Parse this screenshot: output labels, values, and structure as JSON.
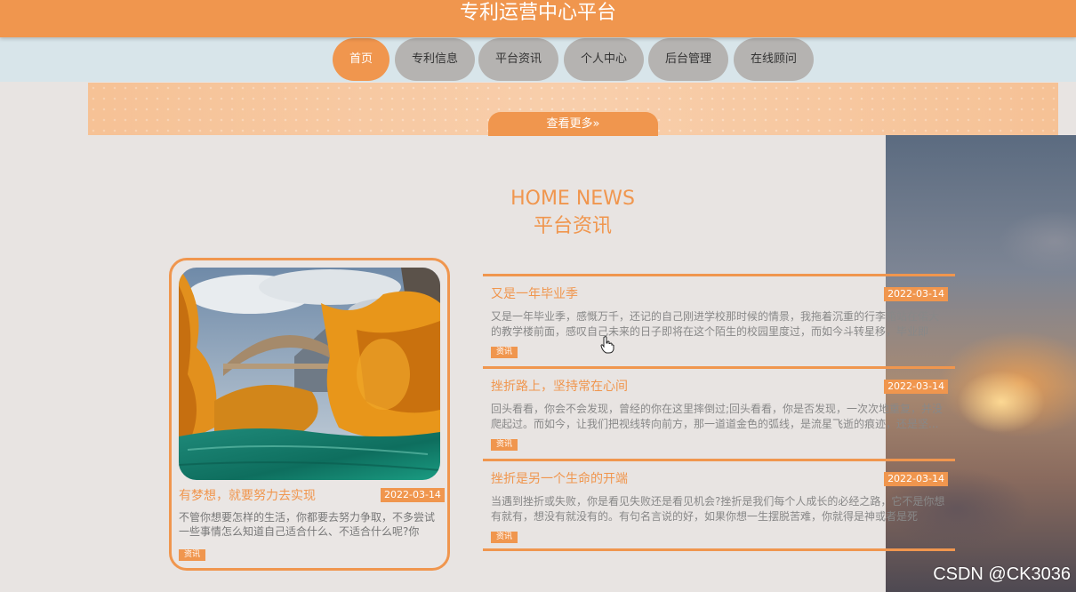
{
  "header": {
    "title": "专利运营中心平台"
  },
  "nav": [
    {
      "label": "首页",
      "active": true
    },
    {
      "label": "专利信息",
      "active": false
    },
    {
      "label": "平台资讯",
      "active": false
    },
    {
      "label": "个人中心",
      "active": false
    },
    {
      "label": "后台管理",
      "active": false
    },
    {
      "label": "在线顾问",
      "active": false
    }
  ],
  "banner": {
    "more_label": "查看更多",
    "more_icon": "double-chevron-right-icon"
  },
  "news_section": {
    "title_en": "HOME NEWS",
    "title_cn": "平台资讯",
    "featured": {
      "title": "有梦想，就要努力去实现",
      "date": "2022-03-14",
      "excerpt": "不管你想要怎样的生活，你都要去努力争取，不多尝试一些事情怎么知道自己适合什么、不适合什么呢?你说...",
      "tag": "资讯"
    },
    "items": [
      {
        "title": "又是一年毕业季",
        "date": "2022-03-14",
        "excerpt": "又是一年毕业季，感慨万千，还记的自己刚进学校那时候的情景，我拖着沉重的行李箱站在偌大的教学楼前面，感叹自己未来的日子即将在这个陌生的校园里度过，而如今斗转星移，毕业即将...",
        "tag": "资讯"
      },
      {
        "title": "挫折路上，坚持常在心间",
        "date": "2022-03-14",
        "excerpt": "回头看看，你会不会发现，曾经的你在这里摔倒过;回头看看，你是否发现，一次次地重复，并没爬起过。而如今，让我们把视线转向前方，那一道道金色的弧线，是流星飞逝的痕迹，还是坚...",
        "tag": "资讯"
      },
      {
        "title": "挫折是另一个生命的开端",
        "date": "2022-03-14",
        "excerpt": "当遇到挫折或失败，你是看见失败还是看见机会?挫折是我们每个人成长的必经之路，它不是你想有就有，想没有就没有的。有句名言说的好，如果你想一生摆脱苦难，你就得是神或者是死尸。...",
        "tag": "资讯"
      }
    ]
  },
  "watermark": "CSDN @CK3036"
}
